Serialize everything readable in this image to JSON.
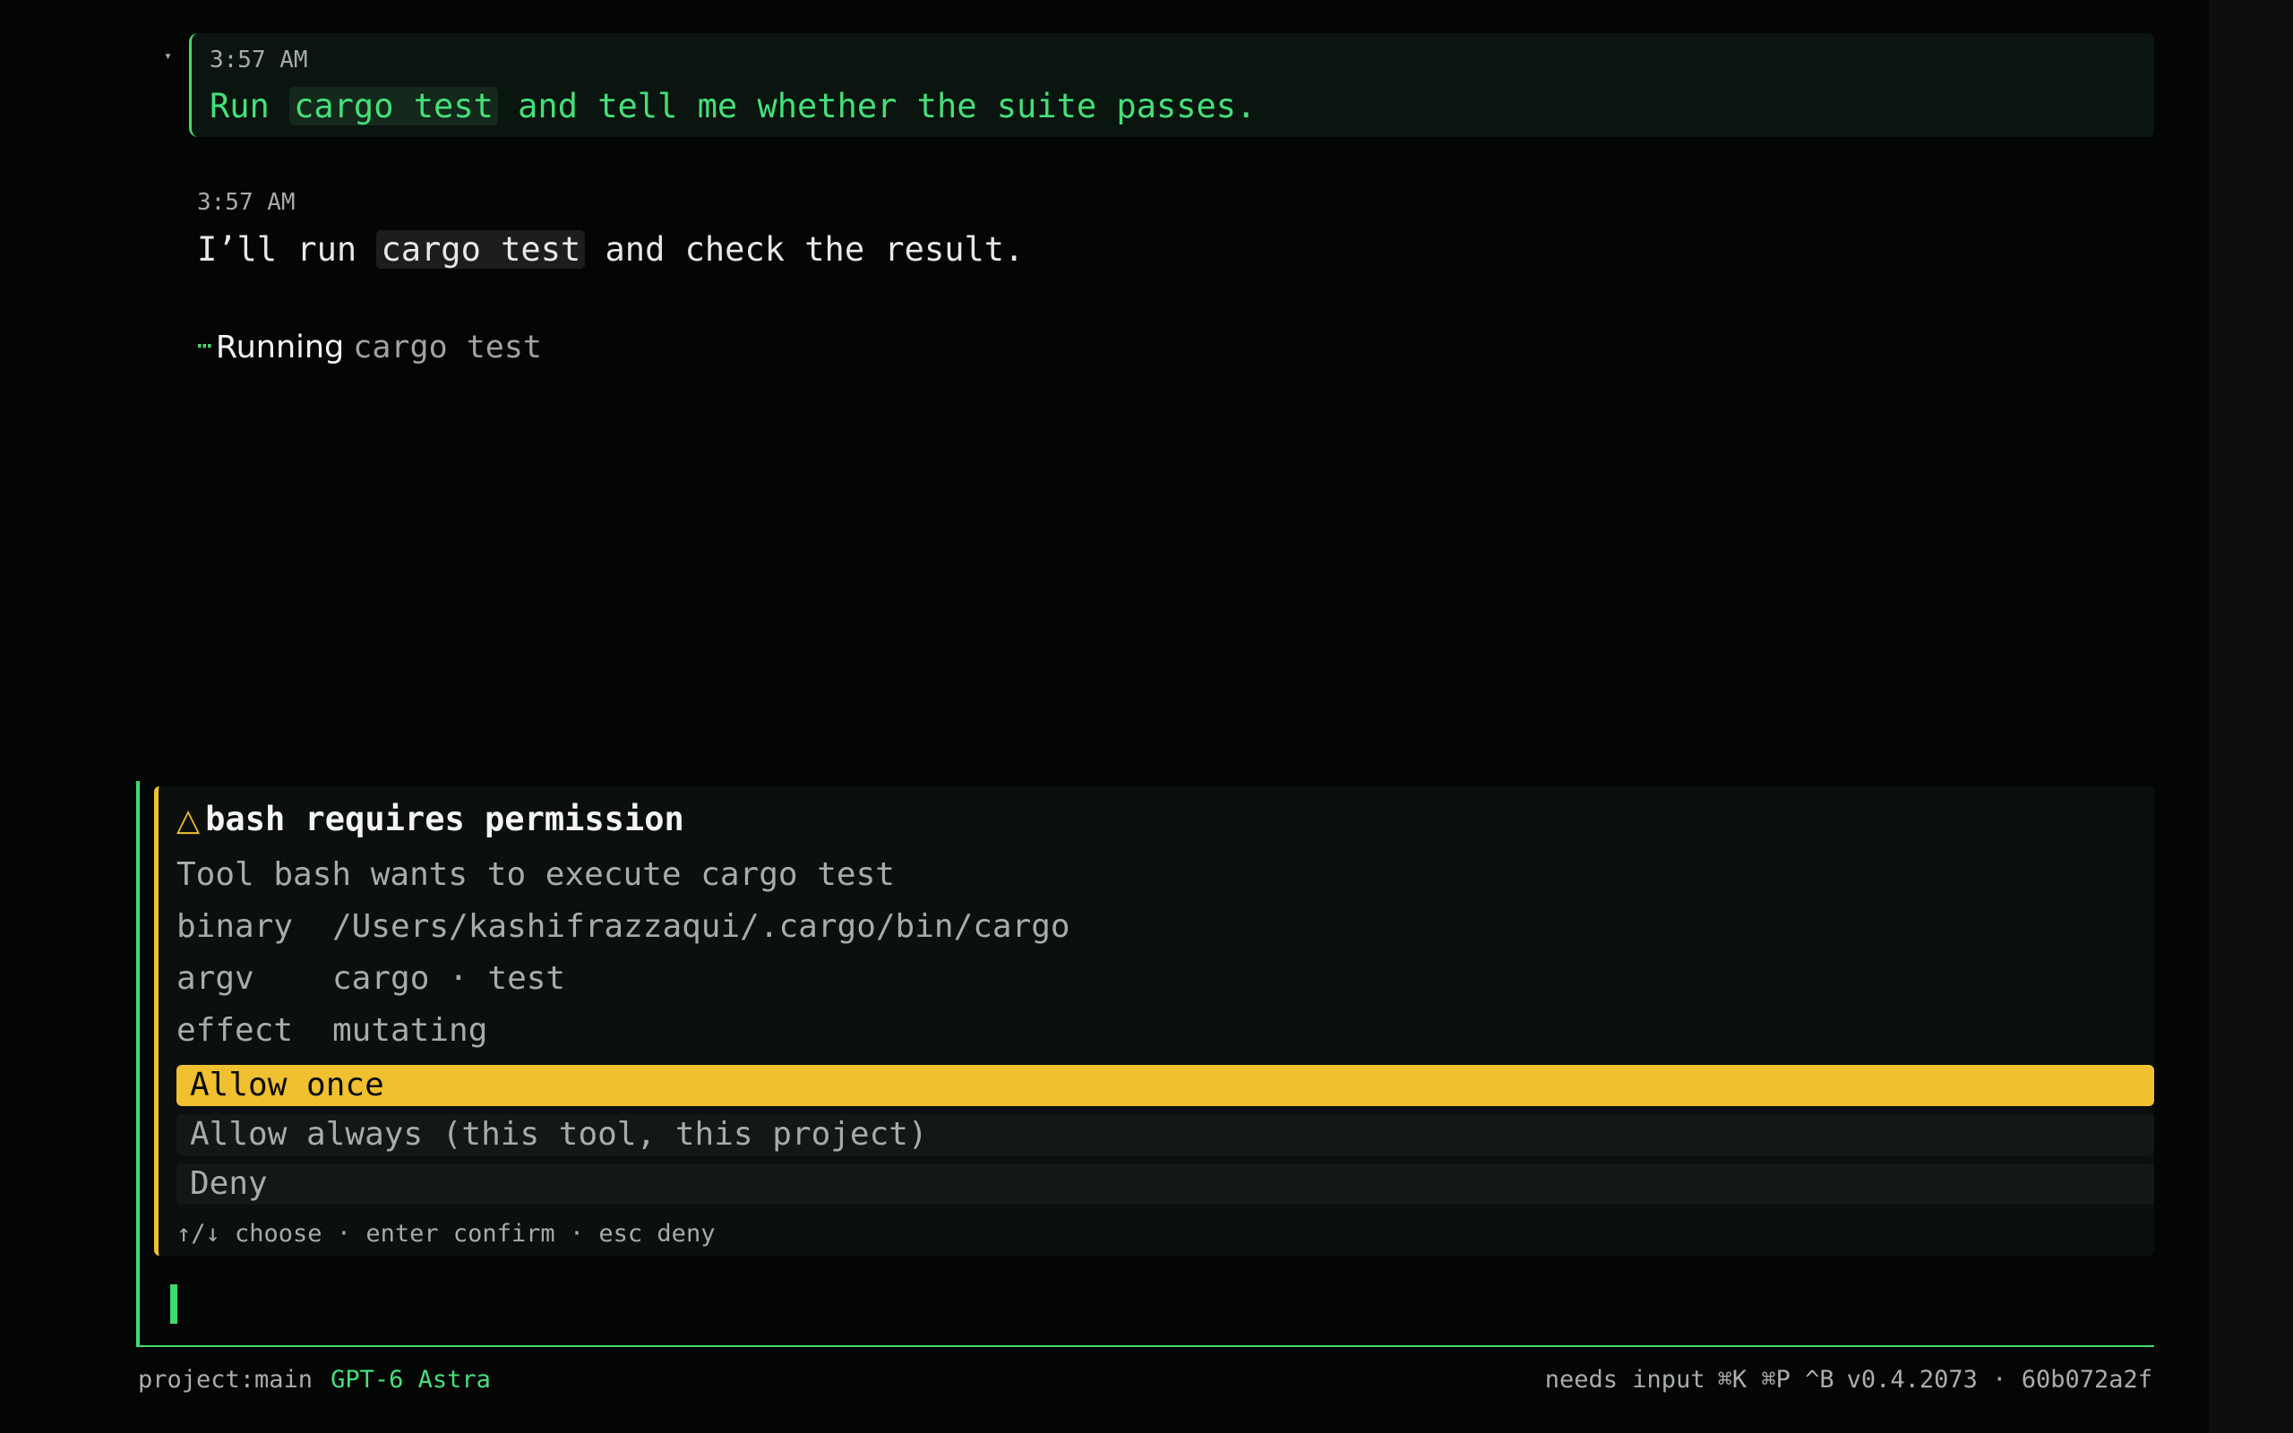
{
  "colors": {
    "background": "#040505",
    "accent_green": "#3fdc6c",
    "warning_yellow": "#f0c030",
    "muted_text": "#a8aca9"
  },
  "user_message": {
    "time": "3:57 AM",
    "text_before": "Run ",
    "code": "cargo test",
    "text_after": " and tell me whether the suite passes.",
    "toggle_icon": "▾"
  },
  "assistant_message": {
    "time": "3:57 AM",
    "text_before": "I’ll run ",
    "code": "cargo test",
    "text_after": " and check the result."
  },
  "running": {
    "icon": "⋯",
    "verb": "Running",
    "command": "cargo test"
  },
  "permission": {
    "warn_icon": "△",
    "title": "bash requires permission",
    "description": "Tool bash wants to execute cargo test",
    "rows": [
      {
        "key": "binary",
        "value": "/Users/kashifrazzaqui/.cargo/bin/cargo"
      },
      {
        "key": "argv",
        "value": "cargo · test"
      },
      {
        "key": "effect",
        "value": "mutating"
      }
    ],
    "options": [
      {
        "label": "Allow once",
        "selected": true
      },
      {
        "label": "Allow always (this tool, this project)",
        "selected": false
      },
      {
        "label": "Deny",
        "selected": false
      }
    ],
    "hint": "↑/↓ choose · enter confirm · esc deny"
  },
  "composer": {
    "value": "",
    "placeholder": ""
  },
  "status_bar": {
    "project": "project:main",
    "model": "GPT-6 Astra",
    "state": "needs input",
    "shortcuts": "⌘K ⌘P ^B",
    "version": "v0.4.2073 · 60b072a2f"
  }
}
